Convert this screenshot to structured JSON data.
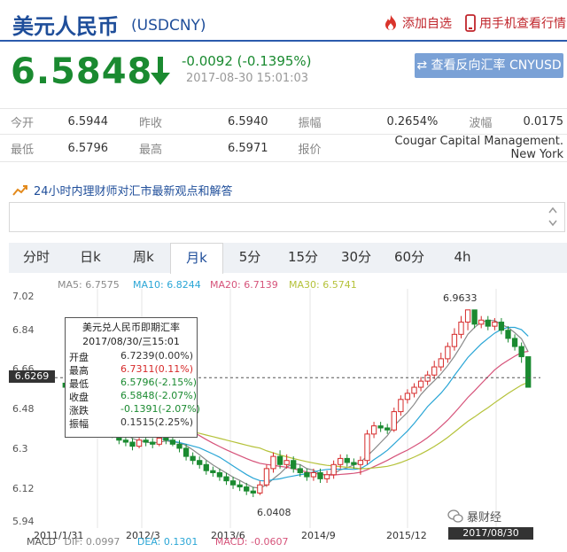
{
  "header": {
    "title": "美元人民币",
    "code": "(USDCNY)",
    "add_fav": "添加自选",
    "mobile": "用手机查看行情"
  },
  "quote": {
    "price": "6.5848",
    "change": "-0.0092 (-0.1395%)",
    "time": "2017-08-30 15:01:03",
    "reverse_btn": "查看反向汇率 CNYUSD"
  },
  "stats": [
    [
      {
        "l": "今开",
        "v": "6.5944"
      },
      {
        "l": "昨收",
        "v": "6.5940"
      },
      {
        "l": "振幅",
        "v": "0.2654%"
      },
      {
        "l": "波幅",
        "v": "0.0175"
      }
    ],
    [
      {
        "l": "最低",
        "v": "6.5796"
      },
      {
        "l": "最高",
        "v": "6.5971"
      },
      {
        "l": "报价",
        "v": "Cougar Capital Management. New York"
      }
    ]
  ],
  "ad": {
    "text": "24小时内理财师对汇市最新观点和解答"
  },
  "tabs": [
    "分时",
    "日k",
    "周k",
    "月k",
    "5分",
    "15分",
    "30分",
    "60分",
    "4h"
  ],
  "chart_data": {
    "type": "candlestick",
    "ma": [
      {
        "name": "MA5: 6.7575",
        "color": "#8a8a8a"
      },
      {
        "name": "MA10: 6.8244",
        "color": "#2aa6d6"
      },
      {
        "name": "MA20: 6.7139",
        "color": "#d6537a"
      },
      {
        "name": "MA30: 6.5741",
        "color": "#b5c23a"
      }
    ],
    "y_ticks": [
      "7.02",
      "6.84",
      "6.66",
      "6.48",
      "6.3",
      "6.12",
      "5.94"
    ],
    "ylim": [
      5.94,
      7.02
    ],
    "x_ticks": [
      "2011/1/31",
      "2012/3",
      "2013/6",
      "2014/9",
      "2015/12"
    ],
    "annotations": {
      "high": "6.9633",
      "low": "6.0408",
      "current": "6.6269"
    },
    "date_badge": "2017/08/30 15:01",
    "watermark": "暴财经",
    "tooltip": {
      "title": "美元兑人民币即期汇率",
      "date": "2017/08/30/三15:01",
      "rows": [
        {
          "k": "开盘",
          "v": "6.7239(0.00%)",
          "c": "#333"
        },
        {
          "k": "最高",
          "v": "6.7311(0.11%)",
          "c": "#d62a2a"
        },
        {
          "k": "最低",
          "v": "6.5796(-2.15%)",
          "c": "#1a8a30"
        },
        {
          "k": "收盘",
          "v": "6.5848(-2.07%)",
          "c": "#1a8a30"
        },
        {
          "k": "涨跌",
          "v": "-0.1391(-2.07%)",
          "c": "#1a8a30"
        },
        {
          "k": "振幅",
          "v": "0.1515(2.25%)",
          "c": "#333"
        }
      ]
    },
    "bottom": [
      "MACD",
      "DIF: 0.0997",
      "DEA: 0.1301",
      "MACD: -0.0607"
    ],
    "candles": [
      [
        6.6,
        6.58,
        6.62,
        6.56
      ],
      [
        6.58,
        6.55,
        6.6,
        6.53
      ],
      [
        6.55,
        6.52,
        6.57,
        6.5
      ],
      [
        6.52,
        6.47,
        6.54,
        6.45
      ],
      [
        6.47,
        6.44,
        6.49,
        6.42
      ],
      [
        6.44,
        6.4,
        6.46,
        6.38
      ],
      [
        6.4,
        6.37,
        6.42,
        6.35
      ],
      [
        6.37,
        6.35,
        6.39,
        6.33
      ],
      [
        6.35,
        6.32,
        6.37,
        6.3
      ],
      [
        6.32,
        6.31,
        6.34,
        6.29
      ],
      [
        6.31,
        6.29,
        6.33,
        6.27
      ],
      [
        6.29,
        6.32,
        6.34,
        6.28
      ],
      [
        6.32,
        6.31,
        6.34,
        6.29
      ],
      [
        6.31,
        6.3,
        6.33,
        6.28
      ],
      [
        6.3,
        6.33,
        6.35,
        6.29
      ],
      [
        6.33,
        6.32,
        6.35,
        6.3
      ],
      [
        6.32,
        6.3,
        6.34,
        6.29
      ],
      [
        6.3,
        6.28,
        6.32,
        6.26
      ],
      [
        6.28,
        6.24,
        6.3,
        6.22
      ],
      [
        6.24,
        6.22,
        6.26,
        6.2
      ],
      [
        6.22,
        6.2,
        6.24,
        6.18
      ],
      [
        6.2,
        6.17,
        6.22,
        6.15
      ],
      [
        6.17,
        6.16,
        6.19,
        6.14
      ],
      [
        6.16,
        6.14,
        6.18,
        6.12
      ],
      [
        6.14,
        6.12,
        6.16,
        6.1
      ],
      [
        6.12,
        6.1,
        6.14,
        6.08
      ],
      [
        6.1,
        6.09,
        6.12,
        6.07
      ],
      [
        6.09,
        6.07,
        6.11,
        6.05
      ],
      [
        6.07,
        6.06,
        6.09,
        6.04
      ],
      [
        6.06,
        6.1,
        6.12,
        6.05
      ],
      [
        6.1,
        6.18,
        6.2,
        6.09
      ],
      [
        6.18,
        6.24,
        6.26,
        6.16
      ],
      [
        6.24,
        6.2,
        6.27,
        6.18
      ],
      [
        6.2,
        6.22,
        6.25,
        6.18
      ],
      [
        6.22,
        6.18,
        6.24,
        6.16
      ],
      [
        6.18,
        6.16,
        6.2,
        6.14
      ],
      [
        6.16,
        6.14,
        6.18,
        6.12
      ],
      [
        6.14,
        6.16,
        6.18,
        6.12
      ],
      [
        6.16,
        6.13,
        6.18,
        6.11
      ],
      [
        6.13,
        6.15,
        6.17,
        6.11
      ],
      [
        6.15,
        6.2,
        6.22,
        6.13
      ],
      [
        6.2,
        6.23,
        6.25,
        6.18
      ],
      [
        6.23,
        6.21,
        6.25,
        6.19
      ],
      [
        6.21,
        6.2,
        6.23,
        6.18
      ],
      [
        6.2,
        6.22,
        6.24,
        6.15
      ],
      [
        6.22,
        6.35,
        6.37,
        6.2
      ],
      [
        6.35,
        6.39,
        6.41,
        6.33
      ],
      [
        6.39,
        6.38,
        6.41,
        6.36
      ],
      [
        6.38,
        6.37,
        6.4,
        6.35
      ],
      [
        6.37,
        6.46,
        6.48,
        6.36
      ],
      [
        6.46,
        6.52,
        6.54,
        6.44
      ],
      [
        6.52,
        6.55,
        6.57,
        6.5
      ],
      [
        6.55,
        6.58,
        6.6,
        6.53
      ],
      [
        6.58,
        6.61,
        6.63,
        6.56
      ],
      [
        6.61,
        6.64,
        6.66,
        6.59
      ],
      [
        6.64,
        6.68,
        6.71,
        6.62
      ],
      [
        6.68,
        6.72,
        6.75,
        6.66
      ],
      [
        6.72,
        6.78,
        6.8,
        6.7
      ],
      [
        6.78,
        6.84,
        6.87,
        6.76
      ],
      [
        6.84,
        6.9,
        6.93,
        6.82
      ],
      [
        6.9,
        6.96,
        6.96,
        6.86
      ],
      [
        6.96,
        6.89,
        6.96,
        6.87
      ],
      [
        6.89,
        6.91,
        6.93,
        6.87
      ],
      [
        6.91,
        6.88,
        6.93,
        6.86
      ],
      [
        6.88,
        6.9,
        6.92,
        6.86
      ],
      [
        6.9,
        6.86,
        6.92,
        6.84
      ],
      [
        6.86,
        6.82,
        6.88,
        6.8
      ],
      [
        6.82,
        6.78,
        6.84,
        6.76
      ],
      [
        6.78,
        6.73,
        6.8,
        6.7
      ],
      [
        6.73,
        6.58,
        6.73,
        6.58
      ]
    ]
  }
}
